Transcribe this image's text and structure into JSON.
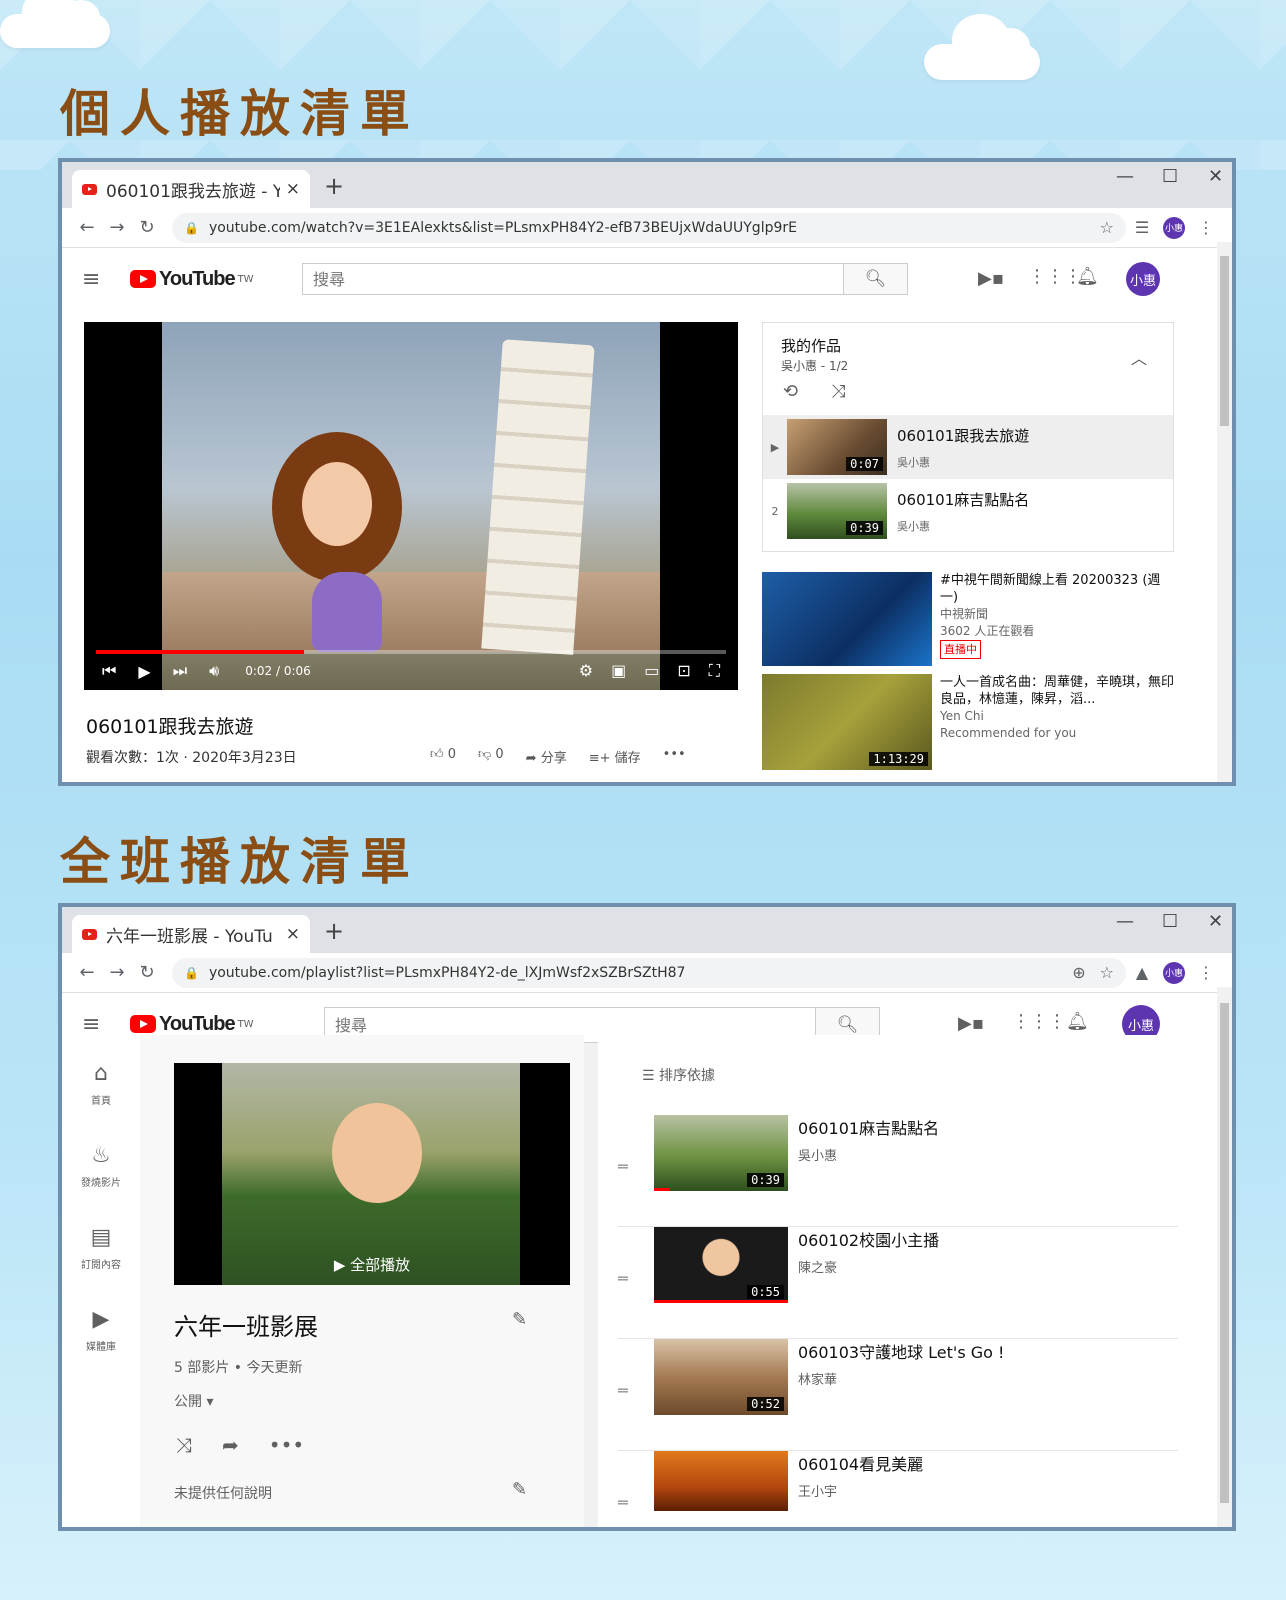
{
  "sections": {
    "personal_title": "個人播放清單",
    "class_title": "全班播放清單"
  },
  "browser1": {
    "tab_title": "060101跟我去旅遊 - Yo",
    "tab_close": "×",
    "new_tab": "+",
    "url": "youtube.com/watch?v=3E1EAlexkts&list=PLsmxPH84Y2-efB73BEUjxWdaUUYglp9rE",
    "profile": "小惠",
    "search_placeholder": "搜尋",
    "logo_text": "YouTube",
    "logo_region": "TW",
    "avatar": "小惠",
    "player": {
      "time": "0:02 / 0:06",
      "progress_fraction": 0.33
    },
    "video_title": "060101跟我去旅遊",
    "video_meta": "觀看次數：1次 · 2020年3月23日",
    "likes": "0",
    "dislikes": "0",
    "share": "分享",
    "save": "儲存",
    "more": "•••",
    "playlist": {
      "title": "我的作品",
      "sub": "吳小惠 - 1/2",
      "items": [
        {
          "index": "▶",
          "title": "060101跟我去旅遊",
          "channel": "吳小惠",
          "duration": "0:07"
        },
        {
          "index": "2",
          "title": "060101麻吉點點名",
          "channel": "吳小惠",
          "duration": "0:39"
        }
      ]
    },
    "recommended": [
      {
        "title": "#中視午間新聞線上看 20200323 (週一)",
        "channel": "中視新聞",
        "meta": "3602 人正在觀看",
        "badge": "直播中"
      },
      {
        "title": "一人一首成名曲：周華健，辛曉琪，無印良品，林憶蓮，陳昇，滔...",
        "channel": "Yen Chi",
        "meta": "Recommended for you",
        "duration": "1:13:29"
      }
    ]
  },
  "browser2": {
    "tab_title": "六年一班影展 - YouTu",
    "tab_close": "×",
    "new_tab": "+",
    "url": "youtube.com/playlist?list=PLsmxPH84Y2-de_lXJmWsf2xSZBrSZtH87",
    "profile": "小惠",
    "search_placeholder": "搜尋",
    "logo_text": "YouTube",
    "logo_region": "TW",
    "avatar": "小惠",
    "nav": [
      {
        "label": "首頁"
      },
      {
        "label": "發燒影片"
      },
      {
        "label": "訂閱內容"
      },
      {
        "label": "媒體庫"
      }
    ],
    "hero_play": "全部播放",
    "playlist_title": "六年一班影展",
    "stats": "5 部影片 • 今天更新",
    "privacy": "公開",
    "description": "未提供任何說明",
    "sort_label": "排序依據",
    "videos": [
      {
        "title": "060101麻吉點點名",
        "channel": "吳小惠",
        "duration": "0:39"
      },
      {
        "title": "060102校園小主播",
        "channel": "陳之豪",
        "duration": "0:55"
      },
      {
        "title": "060103守護地球 Let's Go !",
        "channel": "林家華",
        "duration": "0:52"
      },
      {
        "title": "060104看見美麗",
        "channel": "王小宇",
        "duration": ""
      }
    ]
  },
  "colors": {
    "title_brown": "#8a4d14",
    "youtube_red": "#ff0000",
    "avatar_purple": "#5e35b1",
    "frame_blue": "#6f8fae"
  }
}
